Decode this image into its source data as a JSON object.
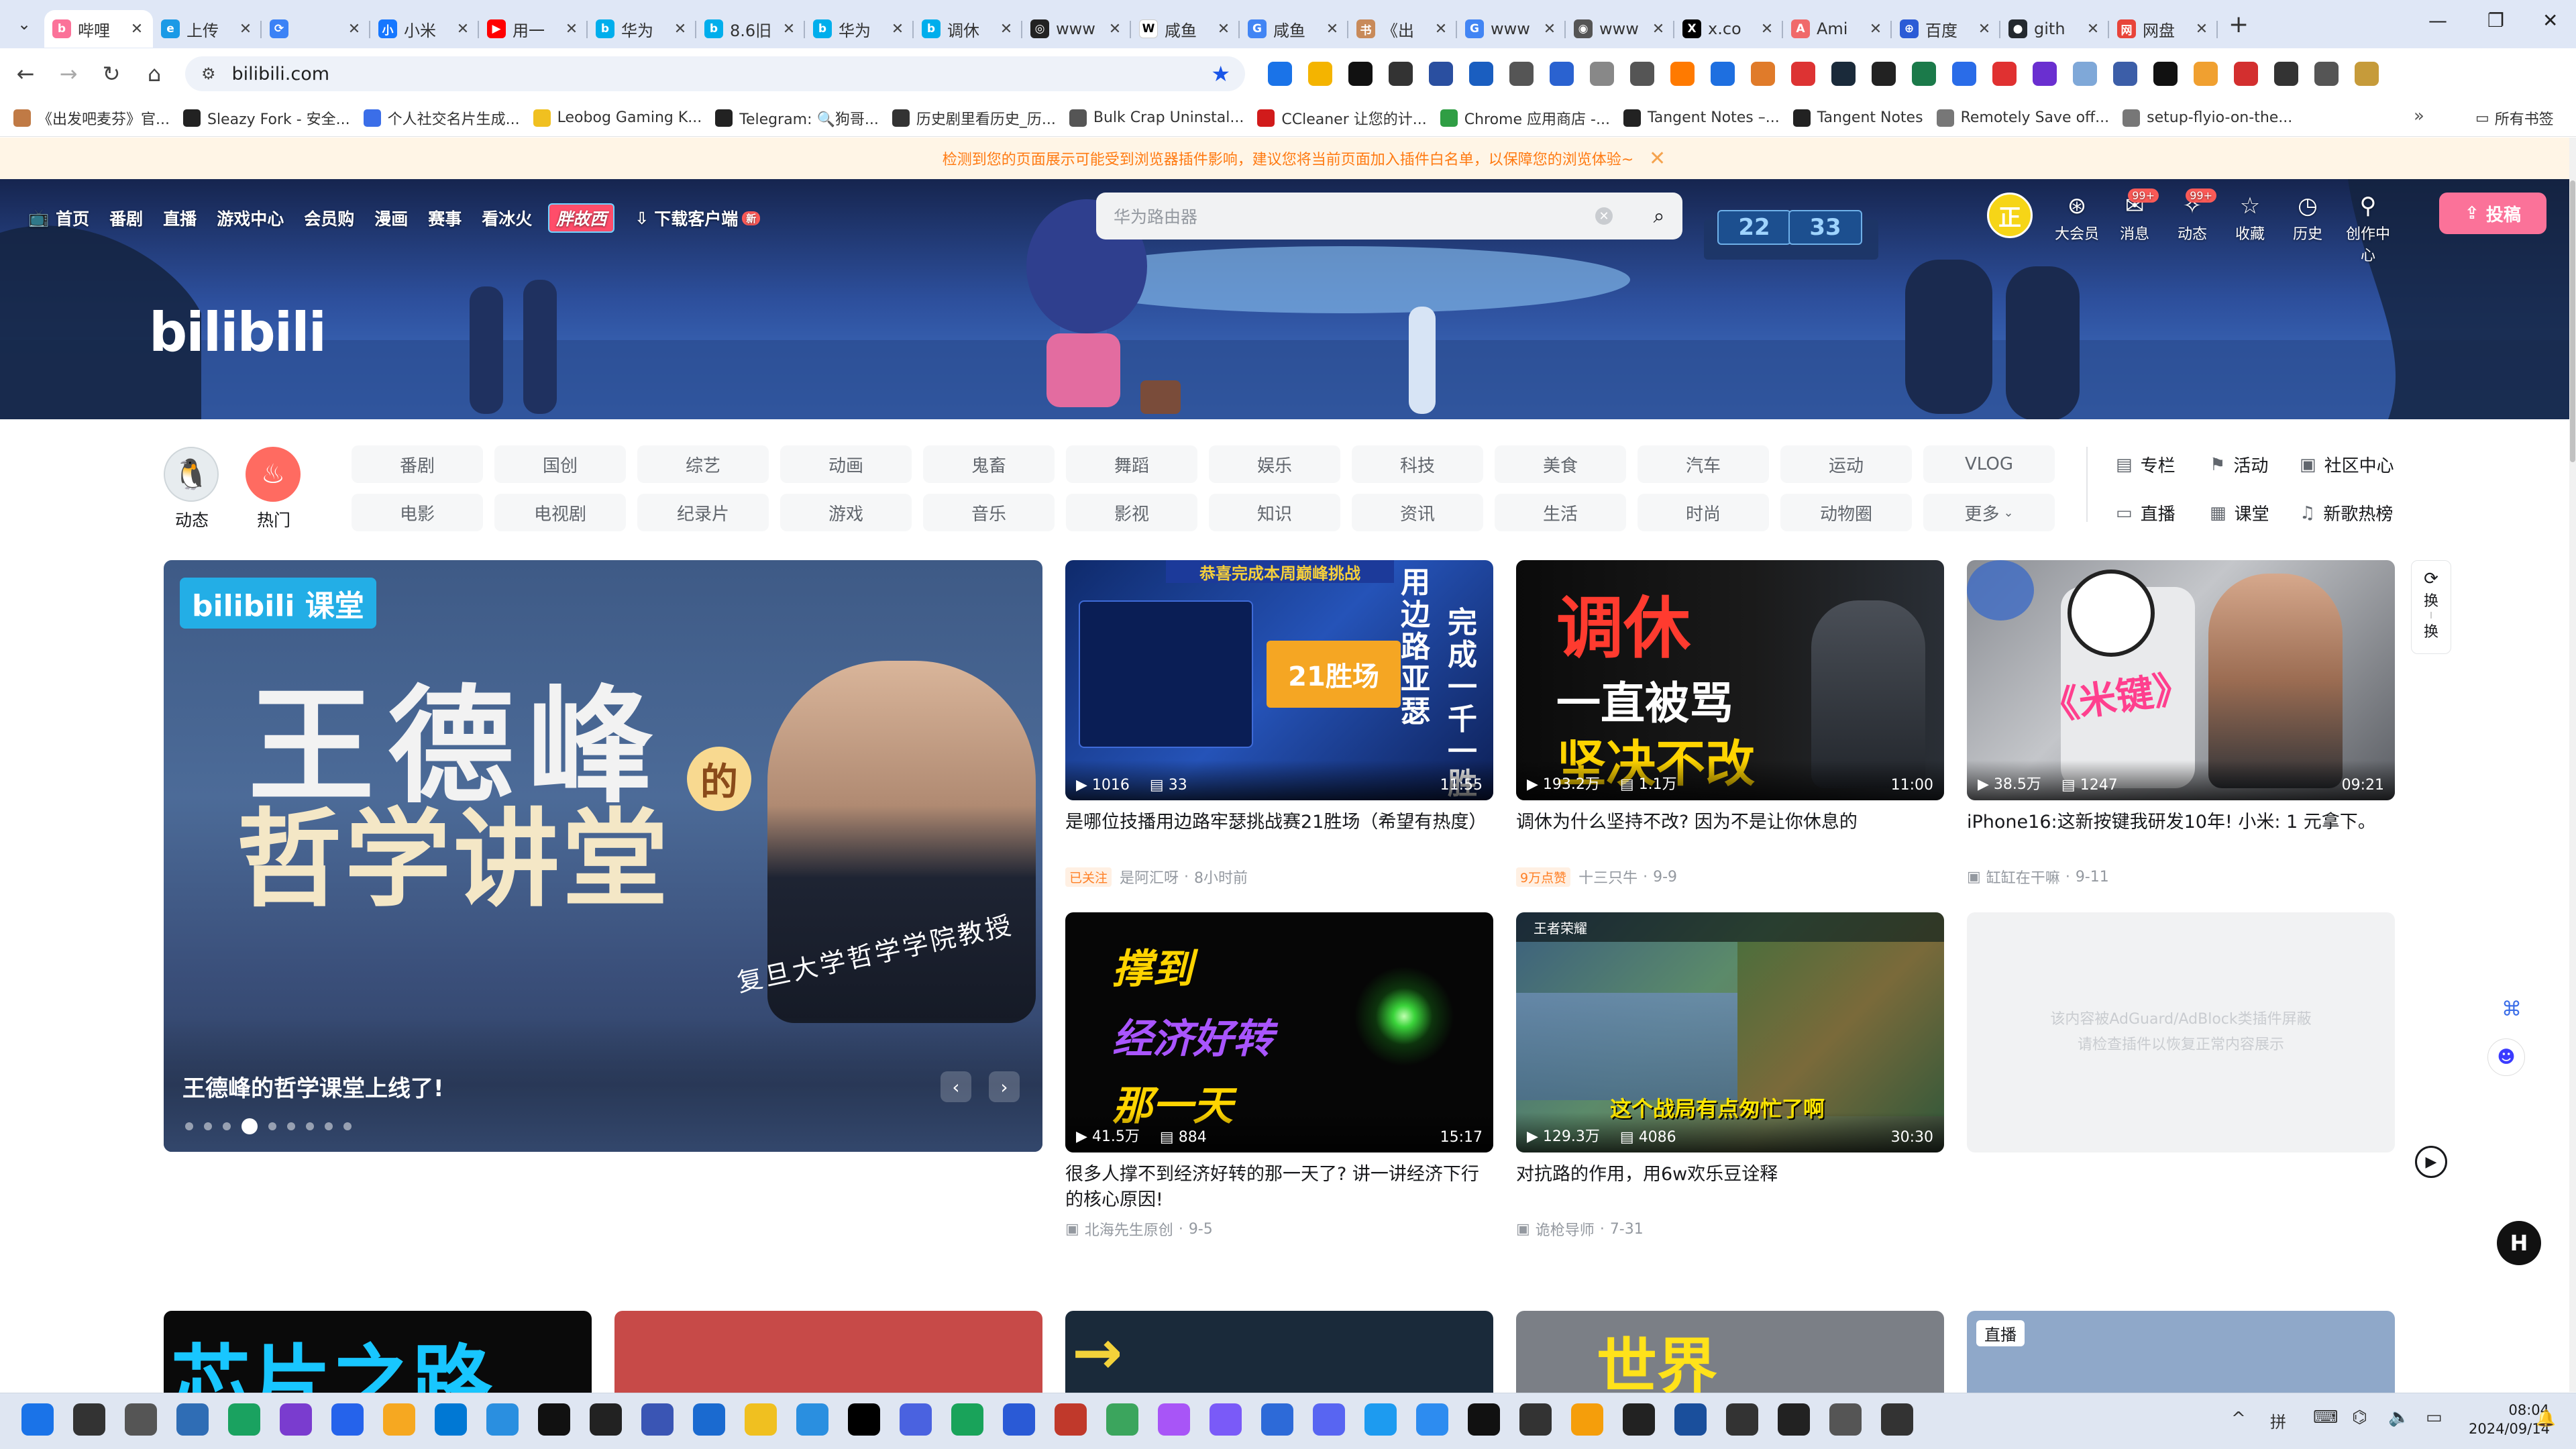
{
  "browser": {
    "tabs": [
      {
        "label": "哔哩",
        "color": "#fb7299",
        "glyph": "b",
        "active": true
      },
      {
        "label": "上传",
        "color": "#1b9ae6",
        "glyph": "e"
      },
      {
        "label": "",
        "color": "#3b82f6",
        "glyph": "⟳"
      },
      {
        "label": "小米",
        "color": "#1677ff",
        "glyph": "小"
      },
      {
        "label": "用一",
        "color": "#ff0000",
        "glyph": "▶"
      },
      {
        "label": "华为",
        "color": "#00aeec",
        "glyph": "b"
      },
      {
        "label": "8.6旧",
        "color": "#00aeec",
        "glyph": "b"
      },
      {
        "label": "华为",
        "color": "#00aeec",
        "glyph": "b"
      },
      {
        "label": "调休",
        "color": "#00aeec",
        "glyph": "b"
      },
      {
        "label": "www",
        "color": "#222222",
        "glyph": "◎"
      },
      {
        "label": "咸鱼",
        "color": "#ffffff",
        "glyph": "W"
      },
      {
        "label": "咸鱼",
        "color": "#4285f4",
        "glyph": "G"
      },
      {
        "label": "《出",
        "color": "#c88a5a",
        "glyph": "书"
      },
      {
        "label": "www",
        "color": "#4285f4",
        "glyph": "G"
      },
      {
        "label": "www",
        "color": "#555555",
        "glyph": "◉"
      },
      {
        "label": "x.co",
        "color": "#000000",
        "glyph": "X"
      },
      {
        "label": "Ami",
        "color": "#f06a6a",
        "glyph": "A"
      },
      {
        "label": "百度",
        "color": "#2b5bd6",
        "glyph": "⊕"
      },
      {
        "label": "gith",
        "color": "#24292f",
        "glyph": "●"
      },
      {
        "label": "网盘",
        "color": "#e8443a",
        "glyph": "网"
      }
    ],
    "url": "bilibili.com",
    "bookmarks": [
      {
        "label": "《出发吧麦芬》官...",
        "color": "#c07a45"
      },
      {
        "label": "Sleazy Fork - 安全...",
        "color": "#222222"
      },
      {
        "label": "个人社交名片生成...",
        "color": "#3b6ee8"
      },
      {
        "label": "Leobog Gaming K...",
        "color": "#f0c020"
      },
      {
        "label": "Telegram: 🔍狗哥...",
        "color": "#222222"
      },
      {
        "label": "历史剧里看历史_历...",
        "color": "#333333"
      },
      {
        "label": "Bulk Crap Uninstal...",
        "color": "#555555"
      },
      {
        "label": "CCleaner 让您的计...",
        "color": "#d11b1b"
      },
      {
        "label": "Chrome 应用商店 -...",
        "color": "#2f9e44"
      },
      {
        "label": "Tangent Notes –...",
        "color": "#222222"
      },
      {
        "label": "Tangent Notes",
        "color": "#222222"
      },
      {
        "label": "Remotely Save off...",
        "color": "#777777"
      },
      {
        "label": "setup-flyio-on-the...",
        "color": "#777777"
      }
    ],
    "all_bookmarks": "所有书签"
  },
  "warning": {
    "text": "检测到您的页面展示可能受到浏览器插件影响，建议您将当前页面加入插件白名单，以保障您的浏览体验~"
  },
  "header": {
    "nav": [
      "首页",
      "番剧",
      "直播",
      "游戏中心",
      "会员购",
      "漫画",
      "赛事",
      "看冰火"
    ],
    "special_tag": "胖故西",
    "download": "下载客户端",
    "download_badge": "新",
    "search_placeholder": "华为路由器",
    "avatar_text": "正",
    "right_icons": [
      {
        "label": "大会员",
        "icon": "vip-icon",
        "glyph": "⊛"
      },
      {
        "label": "消息",
        "icon": "message-icon",
        "glyph": "✉",
        "badge": "99+"
      },
      {
        "label": "动态",
        "icon": "dynamic-icon",
        "glyph": "✧",
        "badge": "99+"
      },
      {
        "label": "收藏",
        "icon": "favorite-icon",
        "glyph": "☆"
      },
      {
        "label": "历史",
        "icon": "history-icon",
        "glyph": "◷"
      },
      {
        "label": "创作中心",
        "icon": "creator-icon",
        "glyph": "⚲"
      }
    ],
    "upload": "投稿",
    "logo": "bilibili",
    "banner_signs": [
      "22",
      "33"
    ]
  },
  "channels": {
    "dynamic": "动态",
    "hot": "热门",
    "row1": [
      "番剧",
      "国创",
      "综艺",
      "动画",
      "鬼畜",
      "舞蹈",
      "娱乐",
      "科技",
      "美食",
      "汽车",
      "运动",
      "VLOG"
    ],
    "row2": [
      "电影",
      "电视剧",
      "纪录片",
      "游戏",
      "音乐",
      "影视",
      "知识",
      "资讯",
      "生活",
      "时尚",
      "动物圈",
      "更多"
    ],
    "side": [
      {
        "label": "专栏",
        "icon": "column-icon",
        "glyph": "▤"
      },
      {
        "label": "活动",
        "icon": "flag-icon",
        "glyph": "⚑"
      },
      {
        "label": "社区中心",
        "icon": "community-icon",
        "glyph": "▣"
      },
      {
        "label": "直播",
        "icon": "live-icon",
        "glyph": "▭"
      },
      {
        "label": "课堂",
        "icon": "classroom-icon",
        "glyph": "▦"
      },
      {
        "label": "新歌热榜",
        "icon": "music-chart-icon",
        "glyph": "♫"
      }
    ]
  },
  "hero": {
    "tag": "bilibili 课堂",
    "title_line1": "王德峰",
    "title_de": "的",
    "title_line2": "哲学讲堂",
    "subtitle": "复旦大学哲学学院教授",
    "caption": "王德峰的哲学课堂上线了!",
    "slides": 9,
    "active_slide": 3
  },
  "cards": [
    {
      "thumb_text": [
        "21胜场",
        "完成一千一胜",
        "用边路亚瑟"
      ],
      "thumb_caption": "恭喜完成本周巅峰挑战",
      "plays": "1016",
      "danmaku": "33",
      "duration": "11:55",
      "title": "是哪位技播用边路牢瑟挑战赛21胜场（希望有热度）",
      "badge": "已关注",
      "author": "是阿汇呀",
      "date": "8小时前"
    },
    {
      "thumb_text": [
        "调休",
        "一直被骂",
        "坚决不改"
      ],
      "plays": "193.2万",
      "danmaku": "1.1万",
      "duration": "11:00",
      "title": "调休为什么坚持不改? 因为不是让你休息的",
      "badge": "9万点赞",
      "author": "十三只牛",
      "date": "9-9"
    },
    {
      "thumb_text": [
        "《米键》"
      ],
      "plays": "38.5万",
      "danmaku": "1247",
      "duration": "09:21",
      "title": "iPhone16:这新按键我研发10年! 小米: 1 元拿下。",
      "badge": "",
      "author": "缸缸在干嘛",
      "date": "9-11"
    },
    {
      "thumb_text": [
        "撑到",
        "经济好转",
        "那一天"
      ],
      "plays": "41.5万",
      "danmaku": "884",
      "duration": "15:17",
      "title": "很多人撑不到经济好转的那一天了? 讲一讲经济下行的核心原因!",
      "badge": "",
      "author": "北海先生原创",
      "date": "9-5"
    },
    {
      "thumb_text": [
        "这个战局有点匆忙了啊"
      ],
      "thumb_caption": "王者荣耀",
      "plays": "129.3万",
      "danmaku": "4086",
      "duration": "30:30",
      "title": "对抗路的作用，用6w欢乐豆诠释",
      "badge": "",
      "author": "诡枪导师",
      "date": "7-31"
    }
  ],
  "blocked": {
    "line1": "该内容被AdGuard/AdBlock类插件屏蔽",
    "line2": "请检查插件以恢复正常内容展示"
  },
  "refresh": {
    "label1": "换",
    "label2": "换"
  },
  "bottom_row": [
    {
      "text": "芯片之路",
      "bg": "#0a0a0a",
      "fg": "#18c6ff"
    },
    {
      "text": "",
      "bg": "#c74a48",
      "fg": "#ffffff"
    },
    {
      "text": "→",
      "bg": "#1a2a3a",
      "fg": "#f3d23a"
    },
    {
      "text": "世界",
      "bg": "#7b7f86",
      "fg": "#ffe21a"
    },
    {
      "text": "直播",
      "bg": "#8fa8c9",
      "fg": "#ffffff"
    }
  ],
  "taskbar": {
    "time": "08:04",
    "date": "2024/09/14"
  },
  "colors": {
    "brand_pink": "#fb7299",
    "brand_blue": "#00aeec",
    "warning_orange": "#ff7a12"
  }
}
